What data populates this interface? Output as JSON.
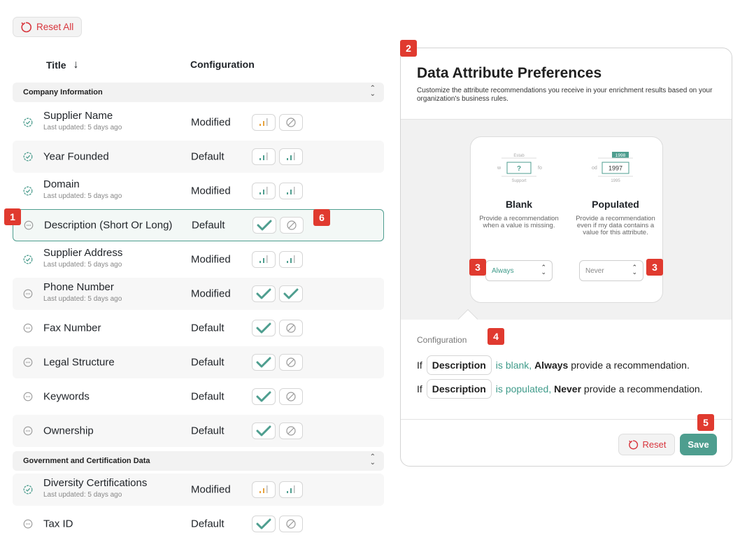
{
  "toolbar": {
    "reset_all_label": "Reset All"
  },
  "columns": {
    "title": "Title",
    "sort_arrow": "↓",
    "configuration": "Configuration"
  },
  "groups": [
    {
      "label": "Company Information"
    },
    {
      "label": "Government and Certification Data"
    }
  ],
  "rows": [
    {
      "name": "Supplier Name",
      "updated": "Last updated: 5 days ago",
      "status": "check",
      "config": "Modified",
      "blank": "bars-orange",
      "populated": "never"
    },
    {
      "name": "Year Founded",
      "updated": "",
      "status": "check",
      "config": "Default",
      "blank": "bars-teal",
      "populated": "bars-teal"
    },
    {
      "name": "Domain",
      "updated": "Last updated: 5 days ago",
      "status": "check",
      "config": "Modified",
      "blank": "bars-teal",
      "populated": "bars-teal"
    },
    {
      "name": "Description (Short Or Long)",
      "updated": "",
      "status": "dots",
      "config": "Default",
      "blank": "checkmark",
      "populated": "never"
    },
    {
      "name": "Supplier Address",
      "updated": "Last updated: 5 days ago",
      "status": "check",
      "config": "Modified",
      "blank": "bars-teal",
      "populated": "bars-teal"
    },
    {
      "name": "Phone Number",
      "updated": "Last updated: 5 days ago",
      "status": "dots",
      "config": "Modified",
      "blank": "checkmark",
      "populated": "checkmark"
    },
    {
      "name": "Fax Number",
      "updated": "",
      "status": "dots",
      "config": "Default",
      "blank": "checkmark",
      "populated": "never"
    },
    {
      "name": "Legal Structure",
      "updated": "",
      "status": "dots",
      "config": "Default",
      "blank": "checkmark",
      "populated": "never"
    },
    {
      "name": "Keywords",
      "updated": "",
      "status": "dots",
      "config": "Default",
      "blank": "checkmark",
      "populated": "never"
    },
    {
      "name": "Ownership",
      "updated": "",
      "status": "dots",
      "config": "Default",
      "blank": "checkmark",
      "populated": "never"
    },
    {
      "name": "Diversity Certifications",
      "updated": "Last updated: 5 days ago",
      "status": "check",
      "config": "Modified",
      "blank": "bars-orange",
      "populated": "bars-teal"
    },
    {
      "name": "Tax ID",
      "updated": "",
      "status": "dots",
      "config": "Default",
      "blank": "checkmark",
      "populated": "never"
    }
  ],
  "badges": [
    "1",
    "2",
    "3",
    "3",
    "4",
    "5",
    "6"
  ],
  "panel": {
    "title": "Data Attribute Preferences",
    "description": "Customize the attribute recommendations you receive in your enrichment results based on your organization's business rules.",
    "blank": {
      "title": "Blank",
      "description": "Provide a recommendation when a value is missing.",
      "select_value": "Always",
      "illustration": {
        "top": "Estab",
        "left": "w",
        "center": "?",
        "right": "fo",
        "bottom": "Support"
      }
    },
    "populated": {
      "title": "Populated",
      "description": "Provide a recommendation even if my data contains a value for this attribute.",
      "select_value": "Never",
      "illustration": {
        "top": "1998",
        "left": "od",
        "center": "1997",
        "bottom": "1995"
      }
    },
    "configuration_label": "Configuration",
    "sentence1": {
      "if": "If",
      "attr": "Description",
      "is": "is",
      "state": "blank,",
      "rule": "Always",
      "rest": "provide a recommendation."
    },
    "sentence2": {
      "if": "If",
      "attr": "Description",
      "is": "is",
      "state": "populated,",
      "rule": "Never",
      "rest": "provide a recommendation."
    },
    "reset_label": "Reset",
    "save_label": "Save"
  },
  "colors": {
    "accent": "#4e9e8f",
    "danger": "#d8343c",
    "badge": "#e03a2f",
    "orange": "#e8a33d"
  }
}
